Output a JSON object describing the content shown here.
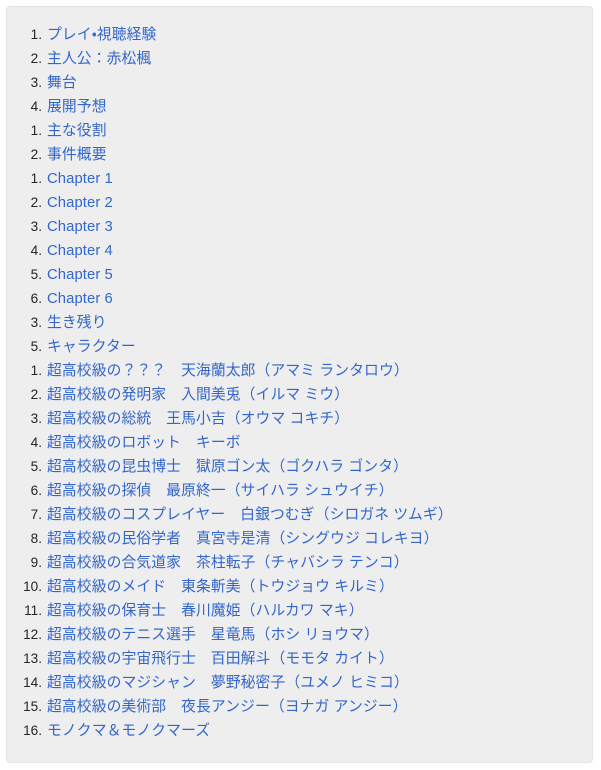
{
  "toc": {
    "container_name": "table-of-contents",
    "background_color": "#eeeeee",
    "border_color": "#e4e4e4",
    "link_color": "#3366cc",
    "number_color": "#252525",
    "sections": [
      {
        "num": "1.",
        "label": "プレイ・視聴経験"
      },
      {
        "num": "2.",
        "label": "主人公：赤松楓"
      },
      {
        "num": "3.",
        "label": "舞台"
      },
      {
        "num": "4.",
        "label": "展開予想"
      },
      {
        "num": "5.",
        "label": "キャラクター"
      }
    ],
    "tenkai_sub": [
      {
        "num": "1.",
        "label": "主な役割"
      },
      {
        "num": "2.",
        "label": "事件概要"
      },
      {
        "num": "3.",
        "label": "生き残り"
      }
    ],
    "chapters": [
      {
        "num": "1.",
        "label": "Chapter 1"
      },
      {
        "num": "2.",
        "label": "Chapter 2"
      },
      {
        "num": "3.",
        "label": "Chapter 3"
      },
      {
        "num": "4.",
        "label": "Chapter 4"
      },
      {
        "num": "5.",
        "label": "Chapter 5"
      },
      {
        "num": "6.",
        "label": "Chapter 6"
      }
    ],
    "characters": [
      {
        "num": "1.",
        "label": "超高校級の？？？　天海蘭太郎（アマミ ランタロウ）"
      },
      {
        "num": "2.",
        "label": "超高校級の発明家　入間美兎（イルマ ミウ）"
      },
      {
        "num": "3.",
        "label": "超高校級の総統　王馬小吉（オウマ コキチ）"
      },
      {
        "num": "4.",
        "label": "超高校級のロボット　キーボ"
      },
      {
        "num": "5.",
        "label": "超高校級の昆虫博士　獄原ゴン太（ゴクハラ ゴンタ）"
      },
      {
        "num": "6.",
        "label": "超高校級の探偵　最原終一（サイハラ シュウイチ）"
      },
      {
        "num": "7.",
        "label": "超高校級のコスプレイヤー　白銀つむぎ（シロガネ ツムギ）"
      },
      {
        "num": "8.",
        "label": "超高校級の民俗学者　真宮寺是清（シングウジ コレキヨ）"
      },
      {
        "num": "9.",
        "label": "超高校級の合気道家　茶柱転子（チャバシラ テンコ）"
      },
      {
        "num": "10.",
        "label": "超高校級のメイド　東条斬美（トウジョウ キルミ）"
      },
      {
        "num": "11.",
        "label": "超高校級の保育士　春川魔姫（ハルカワ マキ）"
      },
      {
        "num": "12.",
        "label": "超高校級のテニス選手　星竜馬（ホシ リョウマ）"
      },
      {
        "num": "13.",
        "label": "超高校級の宇宙飛行士　百田解斗（モモタ カイト）"
      },
      {
        "num": "14.",
        "label": "超高校級のマジシャン　夢野秘密子（ユメノ ヒミコ）"
      },
      {
        "num": "15.",
        "label": "超高校級の美術部　夜長アンジー（ヨナガ アンジー）"
      },
      {
        "num": "16.",
        "label": "モノクマ＆モノクマーズ"
      }
    ]
  }
}
